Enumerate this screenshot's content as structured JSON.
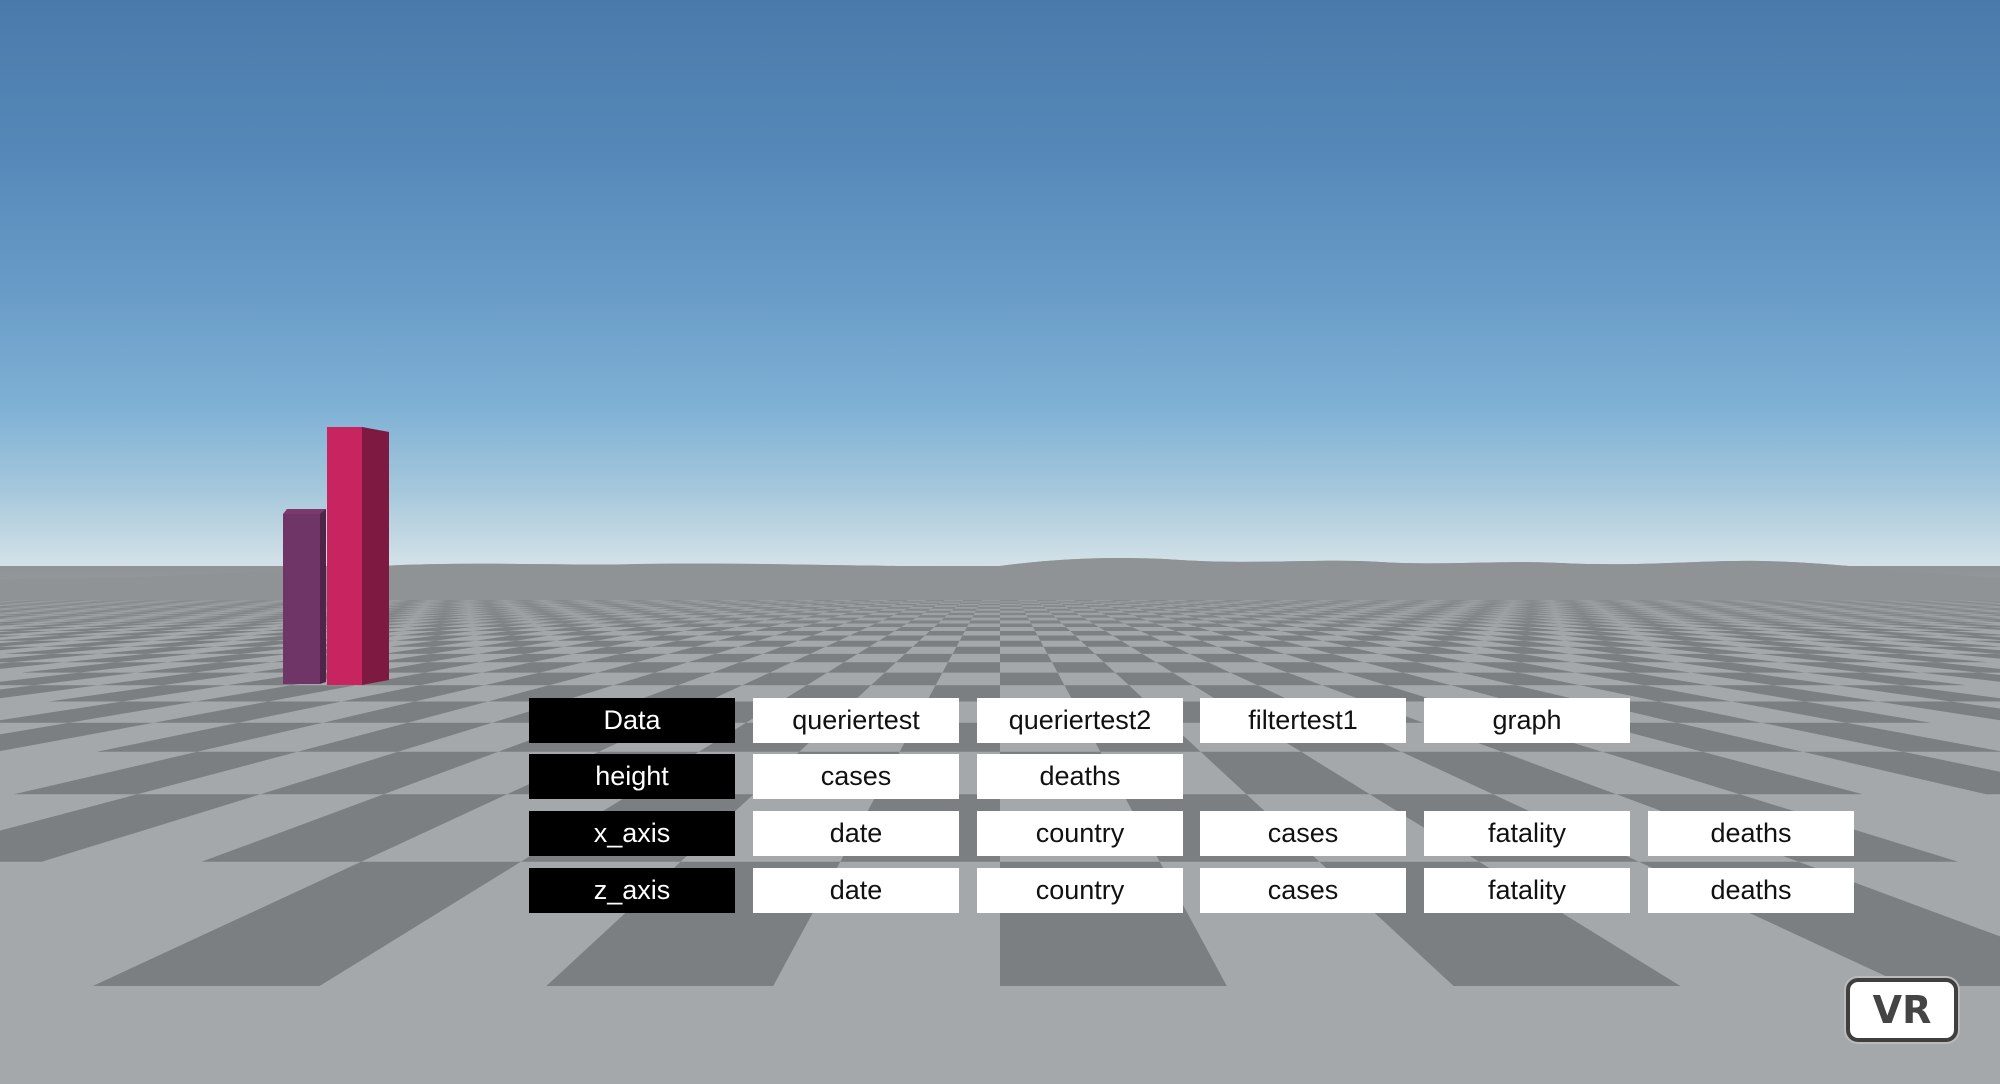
{
  "menu": {
    "rows": [
      {
        "label": "Data",
        "options": [
          "queriertest",
          "queriertest2",
          "filtertest1",
          "graph"
        ]
      },
      {
        "label": "height",
        "options": [
          "cases",
          "deaths"
        ]
      },
      {
        "label": "x_axis",
        "options": [
          "date",
          "country",
          "cases",
          "fatality",
          "deaths"
        ]
      },
      {
        "label": "z_axis",
        "options": [
          "date",
          "country",
          "cases",
          "fatality",
          "deaths"
        ]
      }
    ]
  },
  "vr_button": {
    "label": "VR"
  },
  "colors": {
    "floor_light": "#a5a8aa",
    "floor_dark": "#7c7f82",
    "bar_purple": "#6e3566",
    "bar_pink": "#c8245f"
  }
}
